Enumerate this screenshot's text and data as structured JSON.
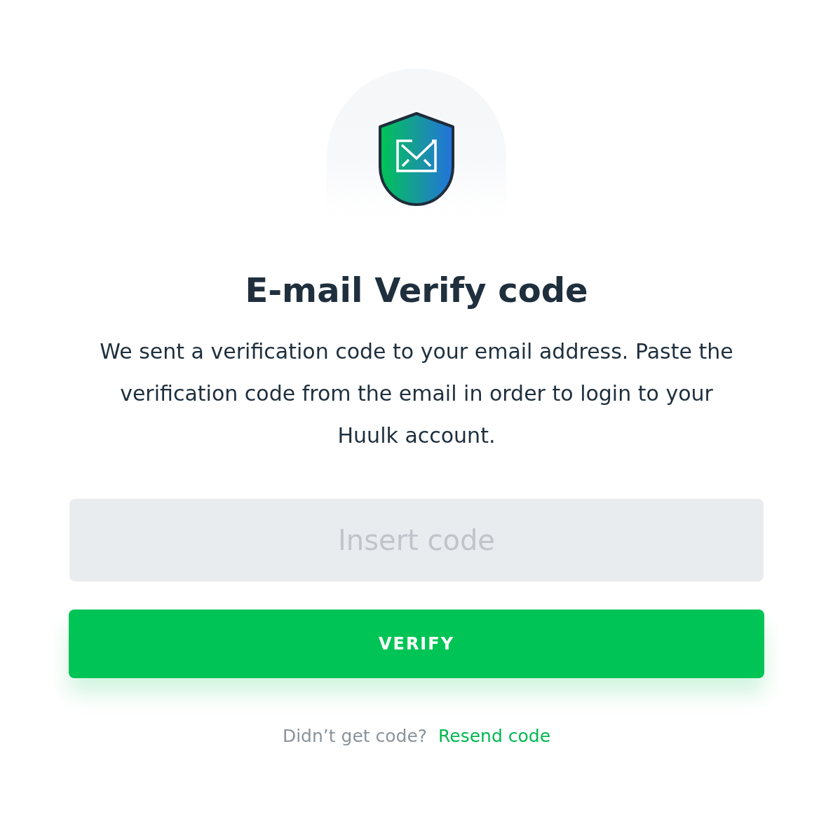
{
  "title": "E-mail Verify code",
  "description": "We sent a verification code to your email address. Paste the verification code from the email in order to login to your Huulk account.",
  "code_field": {
    "placeholder": "Insert code"
  },
  "verify_button": "VERIFY",
  "resend": {
    "prompt": "Didn’t get code?",
    "link": "Resend code"
  }
}
